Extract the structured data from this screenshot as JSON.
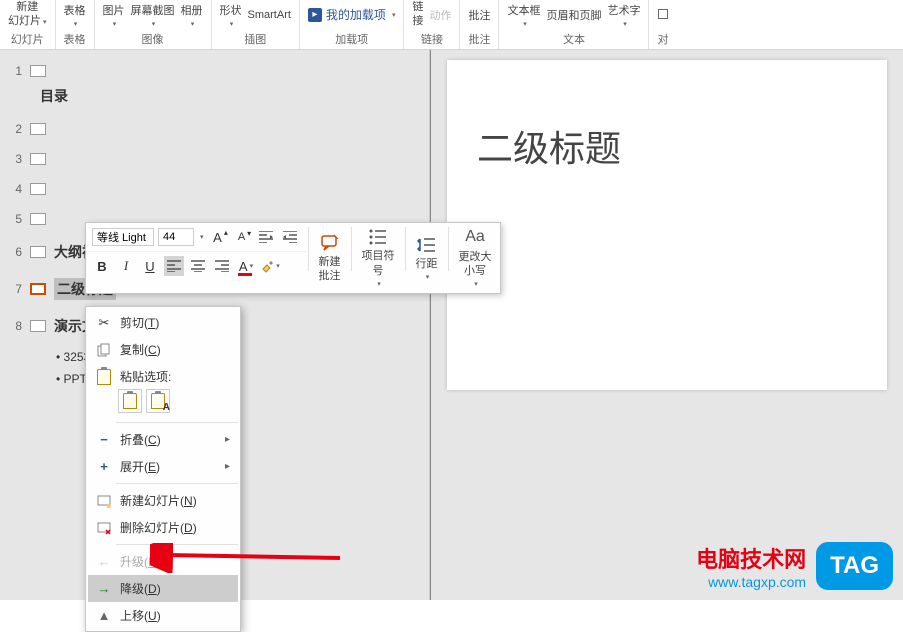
{
  "ribbon": {
    "groups": [
      {
        "label": "幻灯片",
        "items": [
          {
            "top": "新建",
            "bottom": "幻灯片"
          }
        ]
      },
      {
        "label": "表格",
        "items": [
          {
            "top": "表格",
            "bottom": ""
          }
        ]
      },
      {
        "label": "图像",
        "items": [
          {
            "top": "图片",
            "bottom": ""
          },
          {
            "top": "屏幕截图",
            "bottom": ""
          },
          {
            "top": "相册",
            "bottom": ""
          }
        ]
      },
      {
        "label": "插图",
        "items": [
          {
            "top": "形状",
            "bottom": ""
          },
          {
            "top": "SmartArt",
            "bottom": ""
          }
        ]
      },
      {
        "label": "加载项",
        "items": [
          {
            "top": "我的加载项",
            "bottom": "",
            "special": "addin"
          }
        ]
      },
      {
        "label": "链接",
        "items": [
          {
            "top": "链",
            "bottom": "接"
          },
          {
            "top": "动作",
            "bottom": "",
            "disabled": true
          }
        ]
      },
      {
        "label": "批注",
        "items": [
          {
            "top": "批注",
            "bottom": ""
          }
        ]
      },
      {
        "label": "文本",
        "items": [
          {
            "top": "文本框",
            "bottom": ""
          },
          {
            "top": "页眉和页脚",
            "bottom": ""
          },
          {
            "top": "艺术字",
            "bottom": ""
          }
        ]
      }
    ],
    "right_edge": "对"
  },
  "outline": {
    "entries": [
      {
        "num": "1",
        "active": false
      },
      {
        "num": "2",
        "active": false
      },
      {
        "num": "3",
        "active": false
      },
      {
        "num": "4",
        "active": false
      },
      {
        "num": "5",
        "active": false
      },
      {
        "num": "6",
        "active": false,
        "text": "大纲视图"
      },
      {
        "num": "7",
        "active": true,
        "text": "二级标题",
        "highlighted": true
      },
      {
        "num": "8",
        "active": false,
        "text": "演示文稿"
      }
    ],
    "title_text": "目录",
    "body_lines": [
      "• 32535",
      "• PPT"
    ]
  },
  "slide": {
    "title": "二级标题"
  },
  "mini_toolbar": {
    "font_name": "等线 Light",
    "font_size": "44",
    "increase_font": "A",
    "decrease_font": "A",
    "big_buttons": [
      "新建\n批注",
      "项目符\n号",
      "行距",
      "更改大\n小写"
    ]
  },
  "context_menu": {
    "items": [
      {
        "icon": "cut",
        "label": "剪切",
        "key": "T"
      },
      {
        "icon": "copy",
        "label": "复制",
        "key": "C"
      },
      {
        "type": "paste_header",
        "label": "粘贴选项:"
      },
      {
        "type": "paste_options"
      },
      {
        "type": "sep"
      },
      {
        "icon": "collapse",
        "label": "折叠",
        "key": "C",
        "submenu": true
      },
      {
        "icon": "expand",
        "label": "展开",
        "key": "E",
        "submenu": true
      },
      {
        "type": "sep"
      },
      {
        "icon": "newslide",
        "label": "新建幻灯片",
        "key": "N"
      },
      {
        "icon": "delslide",
        "label": "删除幻灯片",
        "key": "D"
      },
      {
        "type": "sep"
      },
      {
        "icon": "promote",
        "label": "升级",
        "key": "P",
        "disabled": true
      },
      {
        "icon": "demote",
        "label": "降级",
        "key": "D",
        "highlighted": true
      },
      {
        "icon": "moveup",
        "label": "上移",
        "key": "U"
      }
    ]
  },
  "watermark": {
    "line1": "电脑技术网",
    "line2": "www.tagxp.com",
    "tag": "TAG"
  }
}
